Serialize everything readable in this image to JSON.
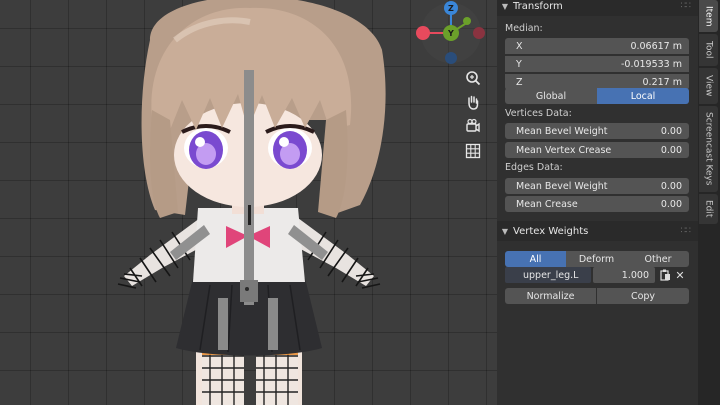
{
  "sidebar_tabs": [
    "Item",
    "Tool",
    "View",
    "Screencast Keys",
    "Edit"
  ],
  "gizmo": {
    "z_label": "Z",
    "y_label": "Y",
    "x_label": "X"
  },
  "viewport_tools": [
    "zoom-icon",
    "hand-icon",
    "camera-icon",
    "grid-icon"
  ],
  "transform": {
    "title": "Transform",
    "median_label": "Median:",
    "x_label": "X",
    "x_value": "0.06617 m",
    "y_label": "Y",
    "y_value": "-0.019533 m",
    "z_label": "Z",
    "z_value": "0.217 m",
    "global_label": "Global",
    "local_label": "Local",
    "active_space": "Local"
  },
  "vertices_data": {
    "title": "Vertices Data:",
    "mean_bevel_weight_label": "Mean Bevel Weight",
    "mean_bevel_weight_value": "0.00",
    "mean_vertex_crease_label": "Mean Vertex Crease",
    "mean_vertex_crease_value": "0.00"
  },
  "edges_data": {
    "title": "Edges Data:",
    "mean_bevel_weight_label": "Mean Bevel Weight",
    "mean_bevel_weight_value": "0.00",
    "mean_crease_label": "Mean Crease",
    "mean_crease_value": "0.00"
  },
  "vertex_weights": {
    "title": "Vertex Weights",
    "tabs": [
      "All",
      "Deform",
      "Other"
    ],
    "active_tab": "All",
    "group_name": "upper_leg.L",
    "group_weight": "1.000",
    "normalize_label": "Normalize",
    "copy_label": "Copy"
  },
  "colors": {
    "accent": "#4772b3",
    "panel_bg": "#303030",
    "field_bg": "#545454",
    "gizmo_x": "#e74a5d",
    "gizmo_y": "#6ba02a",
    "gizmo_z": "#3a86d8"
  }
}
